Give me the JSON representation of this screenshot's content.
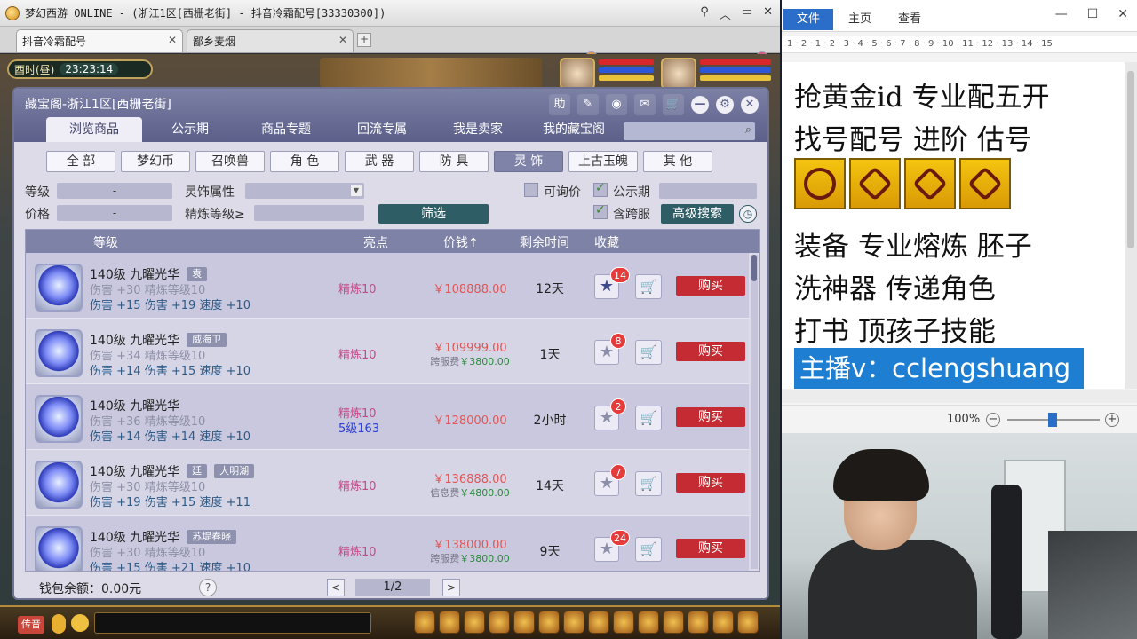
{
  "window": {
    "title": "梦幻西游 ONLINE - (浙江1区[西栅老街] - 抖音冷霜配号[33330300])",
    "tabs": [
      {
        "label": "抖音冷霜配号",
        "active": true
      },
      {
        "label": "鄙乡麦烟",
        "active": false
      }
    ]
  },
  "hud": {
    "period": "酉时(昼)",
    "time": "23:23:14"
  },
  "panel": {
    "title": "藏宝阁-浙江1区[西栅老街]",
    "tools": {
      "help": "助",
      "share": "✎",
      "settings": "◉",
      "chat": "✉",
      "cart": "🛒"
    },
    "nav_tabs": [
      "浏览商品",
      "公示期",
      "商品专题",
      "回流专属",
      "我是卖家",
      "我的藏宝阁"
    ],
    "categories": [
      "全 部",
      "梦幻币",
      "召唤兽",
      "角 色",
      "武 器",
      "防 具",
      "灵 饰",
      "上古玉魄",
      "其 他"
    ],
    "active_category": "灵 饰",
    "filters": {
      "level_label": "等级",
      "level_value": "-",
      "price_label": "价格",
      "price_value": "-",
      "attr_label": "灵饰属性",
      "refine_label": "精炼等级≥",
      "filter_button": "筛选",
      "inquiry_label": "可询价",
      "public_label": "公示期",
      "cross_label": "含跨服",
      "adv_search": "高级搜索"
    },
    "columns": {
      "level": "等级",
      "highlight": "亮点",
      "price": "价钱↑",
      "remain": "剩余时间",
      "fav": "收藏"
    },
    "rows": [
      {
        "name": "140级 九曜光华",
        "tag": "袁",
        "stat1": "伤害 +30 精炼等级10",
        "stat2": "伤害 +15 伤害 +19 速度 +10",
        "hl": "精炼10",
        "hl2": "",
        "price": "￥108888.00",
        "fee_label": "",
        "fee_value": "",
        "remain": "12天",
        "fav": "14",
        "fav_on": true,
        "buy": "购买"
      },
      {
        "name": "140级 九曜光华",
        "tag": "威海卫",
        "stat1": "伤害 +34 精炼等级10",
        "stat2": "伤害 +14 伤害 +15 速度 +10",
        "hl": "精炼10",
        "hl2": "",
        "price": "￥109999.00",
        "fee_label": "跨服费",
        "fee_value": "￥3800.00",
        "remain": "1天",
        "fav": "8",
        "fav_on": false,
        "buy": "购买"
      },
      {
        "name": "140级 九曜光华",
        "tag": "",
        "stat1": "伤害 +36 精炼等级10",
        "stat2": "伤害 +14 伤害 +14 速度 +10",
        "hl": "精炼10",
        "hl2": "5级163",
        "price": "￥128000.00",
        "fee_label": "",
        "fee_value": "",
        "remain": "2小时",
        "fav": "2",
        "fav_on": false,
        "buy": "购买"
      },
      {
        "name": "140级 九曜光华",
        "tag": "廷",
        "tag2": "大明湖",
        "stat1": "伤害 +30 精炼等级10",
        "stat2": "伤害 +19 伤害 +15 速度 +11",
        "hl": "精炼10",
        "hl2": "",
        "price": "￥136888.00",
        "fee_label": "信息费",
        "fee_value": "￥4800.00",
        "remain": "14天",
        "fav": "7",
        "fav_on": false,
        "buy": "购买"
      },
      {
        "name": "140级 九曜光华",
        "tag": "苏堤春晓",
        "stat1": "伤害 +30 精炼等级10",
        "stat2": "伤害 +15 伤害 +21 速度 +10",
        "hl": "精炼10",
        "hl2": "",
        "price": "￥138000.00",
        "fee_label": "跨服费",
        "fee_value": "￥3800.00",
        "remain": "9天",
        "fav": "24",
        "fav_on": false,
        "buy": "购买"
      }
    ],
    "footer": {
      "wallet": "钱包余额：0.00元",
      "help": "?",
      "prev": "<",
      "page": "1/2",
      "next": ">"
    }
  },
  "bottom": {
    "chat_button": "传音"
  },
  "word": {
    "tabs": [
      "文件",
      "主页",
      "查看"
    ],
    "ruler": "1 · 2 · 1 · 2 · 3 · 4 · 5 · 6 · 7 · 8 · 9 · 10 · 11 · 12 · 13 · 14 · 15",
    "lines": [
      "抢黄金id 专业配五开",
      "找号配号 进阶 估号",
      "装备 专业熔炼 胚子",
      "洗神器 传递角色",
      "打书 顶孩子技能"
    ],
    "banner": "主播v：cclengshuang",
    "zoom": "100%"
  }
}
